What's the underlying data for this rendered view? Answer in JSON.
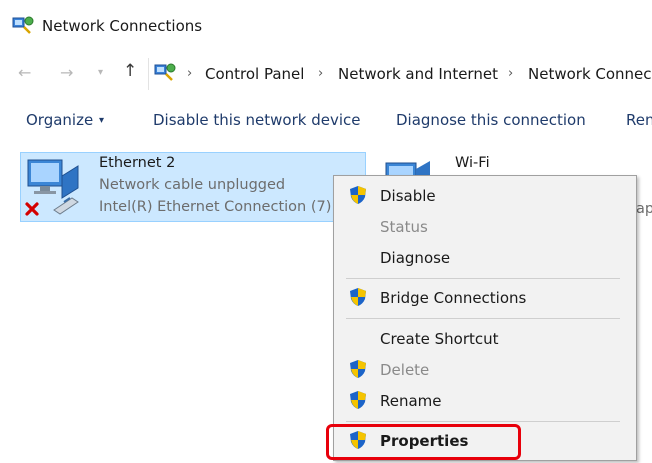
{
  "window": {
    "title": "Network Connections"
  },
  "address": {
    "crumbs": [
      "Control Panel",
      "Network and Internet",
      "Network Connec"
    ]
  },
  "nav": {
    "back": "←",
    "forward": "→",
    "recent": "▾",
    "up": "↑",
    "sep": "›"
  },
  "toolbar": {
    "organize": "Organize",
    "organize_arrow": "▾",
    "disable_device": "Disable this network device",
    "diagnose": "Diagnose this connection",
    "rename": "Ren"
  },
  "adapters": {
    "ethernet": {
      "name": "Ethernet 2",
      "status": "Network cable unplugged",
      "device": "Intel(R) Ethernet Connection (7)"
    },
    "wifi": {
      "name": "Wi-Fi",
      "cut_text": "ap"
    }
  },
  "context_menu": {
    "disable": "Disable",
    "status": "Status",
    "diagnose": "Diagnose",
    "bridge": "Bridge Connections",
    "shortcut": "Create Shortcut",
    "delete": "Delete",
    "rename": "Rename",
    "properties": "Properties"
  },
  "colors": {
    "selection_bg": "#cce8ff",
    "highlight_box": "#e8000b",
    "command_text": "#1f3b6b",
    "disabled_text": "#8a8a8a"
  }
}
